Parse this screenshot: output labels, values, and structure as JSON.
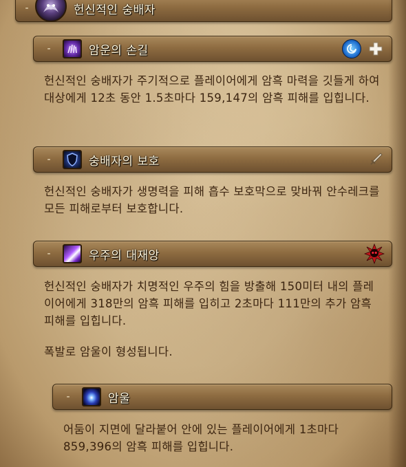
{
  "top_section": {
    "toggle": "-",
    "title": "헌신적인 숭배자"
  },
  "abilities": [
    {
      "toggle": "-",
      "title": "암운의 손길",
      "icon": "shadow-hand-icon",
      "flags": [
        "magic-dispel-icon",
        "healer-icon"
      ],
      "description": "헌신적인 숭배자가 주기적으로 플레이어에게 암흑 마력을 깃들게 하여 대상에게 12초 동안 1.5초마다 159,147의 암흑 피해를 입힙니다."
    },
    {
      "toggle": "-",
      "title": "숭배자의 보호",
      "icon": "shadow-shield-icon",
      "flags": [
        "tank-sword-icon"
      ],
      "description": "헌신적인 숭배자가 생명력을 피해 흡수 보호막으로 맞바꿔 안수레크를 모든 피해로부터 보호합니다."
    },
    {
      "toggle": "-",
      "title": "우주의 대재앙",
      "icon": "cosmic-beam-icon",
      "flags": [
        "deadly-skull-icon"
      ],
      "description": "헌신적인 숭배자가 치명적인 우주의 힘을 방출해 150미터 내의 플레이어에게 318만의 암흑 피해를 입히고 2초마다 111만의 추가 암흑 피해를 입힙니다.",
      "description_extra": "폭발로 암울이 형성됩니다."
    },
    {
      "toggle": "-",
      "title": "암울",
      "icon": "dark-vortex-icon",
      "flags": [],
      "description": "어둠이 지면에 달라붙어 안에 있는 플레이어에게 1초마다 859,396의 암흑 피해를 입힙니다."
    }
  ]
}
